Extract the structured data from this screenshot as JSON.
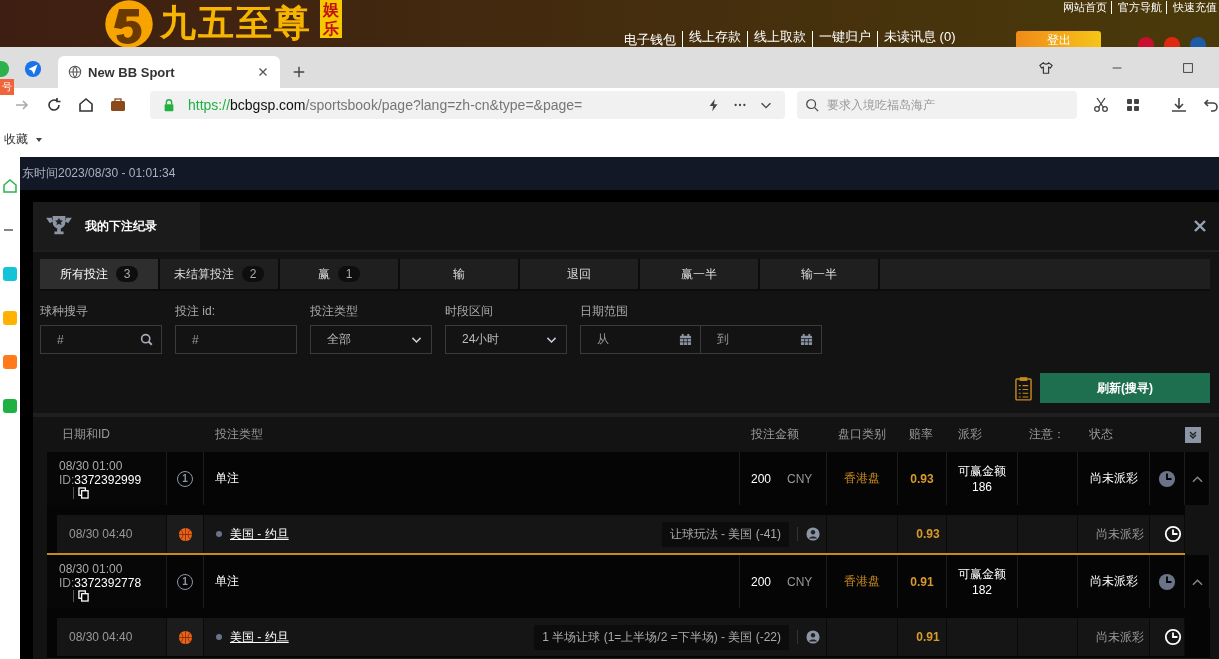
{
  "site": {
    "logo_text": "九五至尊",
    "logo_badge": "娱乐",
    "top_links": [
      "网站首页",
      "官方导航",
      "快速充值"
    ],
    "account_links": [
      "电子钱包",
      "线上存款",
      "线上取款",
      "一键归户",
      "未读讯息 (0)"
    ],
    "logout": "登出"
  },
  "browser": {
    "tab_title": "New BB Sport",
    "url_scheme": "https://",
    "url_host": "bcbgsp.com",
    "url_path": "/sportsbook/page?lang=zh-cn&type=&page=",
    "search_placeholder": "要求入境吃福岛海产",
    "bookmarks_label": "收藏",
    "side_badge": "号"
  },
  "page": {
    "clock": "东时间2023/08/30 - 01:01:34"
  },
  "modal": {
    "title": "我的下注纪录",
    "tabs": [
      {
        "label": "所有投注",
        "count": "3",
        "selected": true
      },
      {
        "label": "未结算投注",
        "count": "2",
        "selected": false
      },
      {
        "label": "赢",
        "count": "1",
        "selected": false
      },
      {
        "label": "输",
        "selected": false
      },
      {
        "label": "退回",
        "selected": false
      },
      {
        "label": "赢一半",
        "selected": false
      },
      {
        "label": "输一半",
        "selected": false
      }
    ],
    "filters": [
      {
        "kind": "search",
        "label": "球种搜寻",
        "placeholder": "#"
      },
      {
        "kind": "text",
        "label": "投注 id:",
        "placeholder": "#"
      },
      {
        "kind": "select",
        "label": "投注类型",
        "value": "全部"
      },
      {
        "kind": "select",
        "label": "时段区间",
        "value": "24小时"
      },
      {
        "kind": "daterange",
        "label": "日期范围",
        "from": "从",
        "to": "到"
      }
    ],
    "refresh_button": "刷新(搜寻)",
    "columns": [
      "日期和ID",
      "投注类型",
      "投注金额",
      "盘口类别",
      "赔率",
      "派彩",
      "注意：",
      "状态"
    ],
    "bets": [
      {
        "date": "08/30 01:00",
        "id_prefix": "ID:",
        "id": "3372392999",
        "legs": "1",
        "type": "单注",
        "amount": "200",
        "currency": "CNY",
        "market": "香港盘",
        "odds": "0.93",
        "payout_label": "可赢金额",
        "payout": "186",
        "status": "尚未派彩",
        "expanded": true,
        "detail": {
          "date": "08/30 04:40",
          "event": "美国 - 约旦",
          "selection": "让球玩法 - 美国 (-41)",
          "odds": "0.93",
          "status": "尚未派彩"
        }
      },
      {
        "date": "08/30 01:00",
        "id_prefix": "ID:",
        "id": "3372392778",
        "legs": "1",
        "type": "单注",
        "amount": "200",
        "currency": "CNY",
        "market": "香港盘",
        "odds": "0.91",
        "payout_label": "可赢金额",
        "payout": "182",
        "status": "尚未派彩",
        "expanded": true,
        "detail": {
          "date": "08/30 04:40",
          "event": "美国 - 约旦",
          "selection": "1 半场让球 (1=上半场/2 =下半场) - 美国 (-22)",
          "odds": "0.91",
          "status": "尚未派彩"
        }
      }
    ]
  }
}
